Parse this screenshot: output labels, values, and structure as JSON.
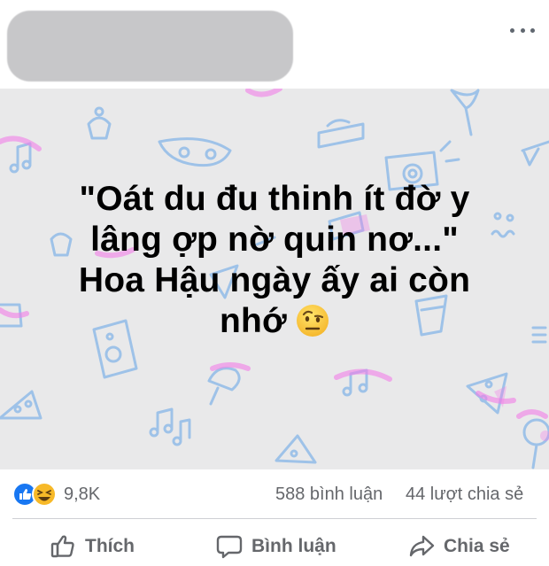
{
  "post": {
    "image_caption_line1": "\"Oát du đu thinh ít đờ y",
    "image_caption_line2": "lâng ợp nờ quin nơ...\"",
    "image_caption_line3": "Hoa Hậu ngày ấy ai còn",
    "image_caption_line4": "nhớ"
  },
  "icons": {
    "more": "more-horizontal-icon",
    "caption_emoji": "face-with-raised-eyebrow-icon",
    "like_reaction": "like-reaction-icon",
    "haha_reaction": "haha-reaction-icon",
    "like_action": "thumbs-up-icon",
    "comment_action": "speech-bubble-icon",
    "share_action": "share-arrow-icon"
  },
  "stats": {
    "reactions": "9,8K",
    "comments": "588 bình luận",
    "shares": "44 lượt chia sẻ"
  },
  "actions": {
    "like_label": "Thích",
    "comment_label": "Bình luận",
    "share_label": "Chia sẻ"
  },
  "colors": {
    "facebook_blue": "#1877f2",
    "haha_yellow": "#f7b928",
    "text_secondary": "#65676b",
    "pattern_blue": "#9ec2e8",
    "pattern_pink": "#f27ee8"
  }
}
